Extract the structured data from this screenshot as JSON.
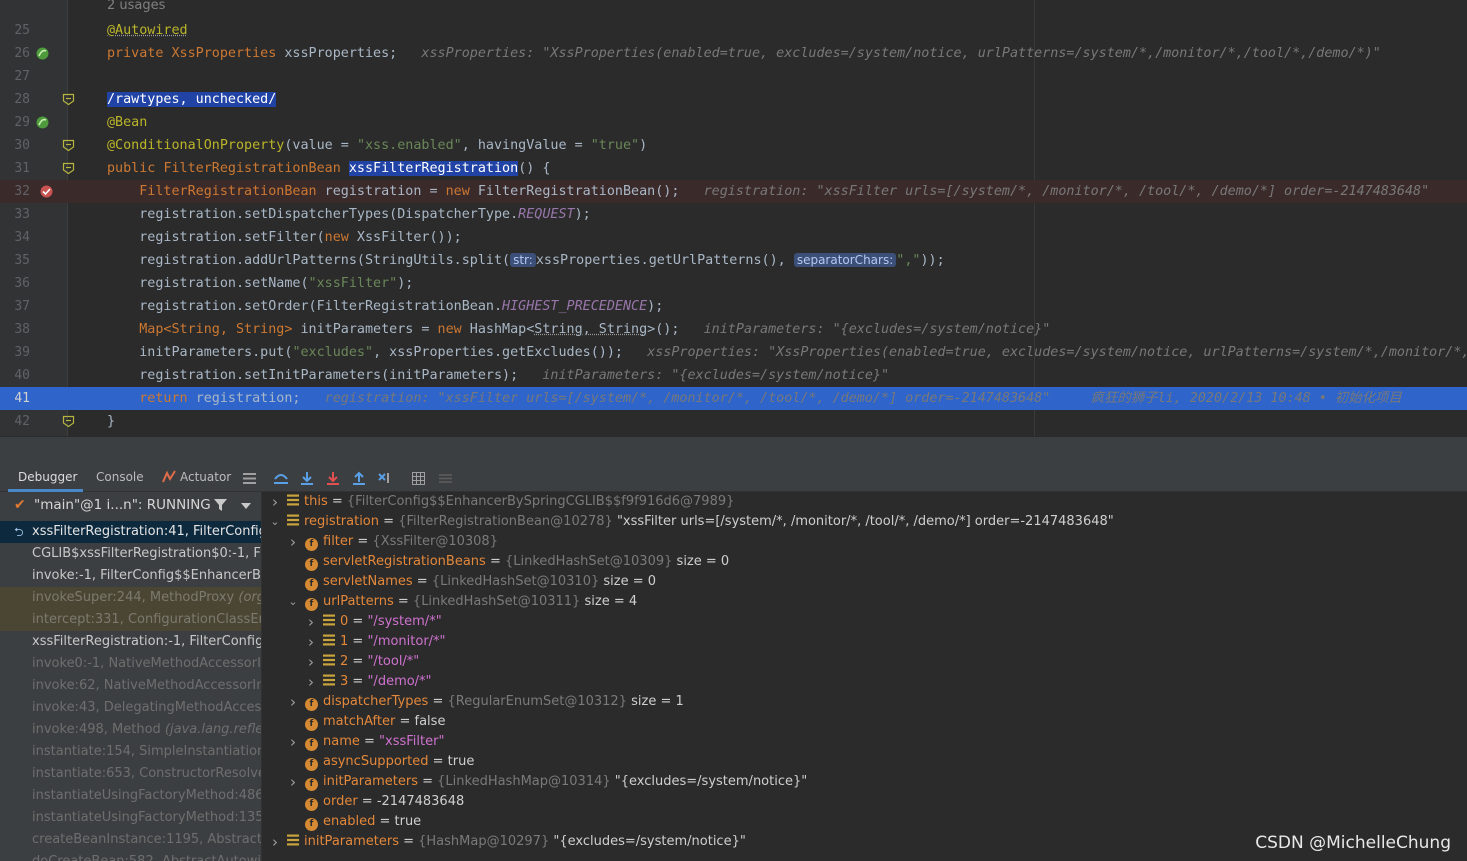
{
  "editor": {
    "usages": "2 usages",
    "lines": [
      {
        "num": "25",
        "parts": [
          {
            "t": "@Autowired",
            "c": "ann wavy"
          }
        ]
      },
      {
        "num": "26",
        "parts": [
          {
            "t": "private ",
            "c": "kw"
          },
          {
            "t": "XssProperties ",
            "c": "kw"
          },
          {
            "t": "xssProperties;",
            "c": ""
          },
          {
            "t": "   xssProperties: \"XssProperties(enabled=true, excludes=/system/notice, urlPatterns=/system/*,/monitor/*,/tool/*,/demo/*)\"",
            "c": "inl"
          }
        ]
      },
      {
        "num": "27",
        "parts": []
      },
      {
        "num": "28",
        "parts": [
          {
            "t": "/rawtypes, unchecked/",
            "c": "sel"
          }
        ]
      },
      {
        "num": "29",
        "parts": [
          {
            "t": "@Bean",
            "c": "ann"
          }
        ]
      },
      {
        "num": "30",
        "parts": [
          {
            "t": "@ConditionalOnProperty",
            "c": "ann"
          },
          {
            "t": "(value = ",
            "c": ""
          },
          {
            "t": "\"xss.enabled\"",
            "c": "str"
          },
          {
            "t": ", havingValue = ",
            "c": ""
          },
          {
            "t": "\"true\"",
            "c": "str"
          },
          {
            "t": ")",
            "c": ""
          }
        ]
      },
      {
        "num": "31",
        "parts": [
          {
            "t": "public ",
            "c": "kw"
          },
          {
            "t": "FilterRegistrationBean ",
            "c": "kw"
          },
          {
            "t": "xssFilterRegistration",
            "c": "sel"
          },
          {
            "t": "() {",
            "c": ""
          }
        ]
      },
      {
        "num": "32",
        "parts": [
          {
            "t": "    FilterRegistrationBean ",
            "c": "kw"
          },
          {
            "t": "registration ",
            "c": ""
          },
          {
            "t": "= ",
            "c": ""
          },
          {
            "t": "new ",
            "c": "kw"
          },
          {
            "t": "FilterRegistrationBean",
            "c": ""
          },
          {
            "t": "();",
            "c": ""
          },
          {
            "t": "   registration: \"xssFilter urls=[/system/*, /monitor/*, /tool/*, /demo/*] order=-2147483648\"",
            "c": "inl"
          }
        ]
      },
      {
        "num": "33",
        "parts": [
          {
            "t": "    registration.setDispatcherTypes(DispatcherType.",
            "c": ""
          },
          {
            "t": "REQUEST",
            "c": "stat"
          },
          {
            "t": ");",
            "c": ""
          }
        ]
      },
      {
        "num": "34",
        "parts": [
          {
            "t": "    registration.setFilter(",
            "c": ""
          },
          {
            "t": "new ",
            "c": "kw"
          },
          {
            "t": "XssFilter());",
            "c": ""
          }
        ]
      },
      {
        "num": "35",
        "parts": [
          {
            "t": "    registration.addUrlPatterns(StringUtils.split(",
            "c": ""
          },
          {
            "t": "str:",
            "c": "hint"
          },
          {
            "t": "xssProperties.getUrlPatterns(), ",
            "c": ""
          },
          {
            "t": "separatorChars:",
            "c": "hint"
          },
          {
            "t": "\",\"",
            "c": "str"
          },
          {
            "t": "));",
            "c": ""
          }
        ]
      },
      {
        "num": "36",
        "parts": [
          {
            "t": "    registration.setName(",
            "c": ""
          },
          {
            "t": "\"xssFilter\"",
            "c": "str"
          },
          {
            "t": ");",
            "c": ""
          }
        ]
      },
      {
        "num": "37",
        "parts": [
          {
            "t": "    registration.setOrder(FilterRegistrationBean.",
            "c": ""
          },
          {
            "t": "HIGHEST_PRECEDENCE",
            "c": "stat"
          },
          {
            "t": ");",
            "c": ""
          }
        ]
      },
      {
        "num": "38",
        "parts": [
          {
            "t": "    Map<String, String> ",
            "c": "kw"
          },
          {
            "t": "initParameters = ",
            "c": ""
          },
          {
            "t": "new ",
            "c": "kw"
          },
          {
            "t": "HashMap<",
            "c": ""
          },
          {
            "t": "String, String",
            "c": "wavy"
          },
          {
            "t": ">();",
            "c": ""
          },
          {
            "t": "   initParameters: \"{excludes=/system/notice}\"",
            "c": "inl"
          }
        ]
      },
      {
        "num": "39",
        "parts": [
          {
            "t": "    initParameters.put(",
            "c": ""
          },
          {
            "t": "\"excludes\"",
            "c": "str"
          },
          {
            "t": ", xssProperties.getExcludes());",
            "c": ""
          },
          {
            "t": "   xssProperties: \"XssProperties(enabled=true, excludes=/system/notice, urlPatterns=/system/*,/monitor/*,/t",
            "c": "inl"
          }
        ]
      },
      {
        "num": "40",
        "parts": [
          {
            "t": "    registration.setInitParameters(initParameters);",
            "c": ""
          },
          {
            "t": "   initParameters: \"{excludes=/system/notice}\"",
            "c": "inl"
          }
        ]
      },
      {
        "num": "41",
        "parts": [
          {
            "t": "    return ",
            "c": "kw"
          },
          {
            "t": "registration;",
            "c": ""
          },
          {
            "t": "   registration: \"xssFilter urls=[/system/*, /monitor/*, /tool/*, /demo/*] order=-2147483648\"     疯狂的狮子li, 2020/2/13 10:48 • 初始化项目",
            "c": "inl"
          }
        ]
      },
      {
        "num": "42",
        "parts": [
          {
            "t": "}",
            "c": ""
          }
        ]
      }
    ]
  },
  "toolbar": {
    "tabs": [
      "Debugger",
      "Console",
      "Actuator"
    ]
  },
  "frames": {
    "thread": "\"main\"@1 i...n\": RUNNING",
    "items": [
      {
        "label": "xssFilterRegistration:41, FilterConfig",
        "pkg": "(",
        "kind": "active"
      },
      {
        "label": "CGLIB$xssFilterRegistration$0:-1, Filte",
        "pkg": "",
        "kind": "app"
      },
      {
        "label": "invoke:-1, FilterConfig$$EnhancerBySp",
        "pkg": "",
        "kind": "app"
      },
      {
        "label": "invokeSuper:244, MethodProxy ",
        "pkg": "(org.",
        "kind": "lib"
      },
      {
        "label": "intercept:331, ConfigurationClassEnh",
        "pkg": "",
        "kind": "lib"
      },
      {
        "label": "xssFilterRegistration:-1, FilterConfig$$",
        "pkg": "",
        "kind": "app"
      },
      {
        "label": "invoke0:-1, NativeMethodAccessorIm",
        "pkg": "",
        "kind": "libg"
      },
      {
        "label": "invoke:62, NativeMethodAccessorImp",
        "pkg": "",
        "kind": "libg"
      },
      {
        "label": "invoke:43, DelegatingMethodAccesso",
        "pkg": "",
        "kind": "libg"
      },
      {
        "label": "invoke:498, Method ",
        "pkg": "(java.lang.reflect.",
        "kind": "libg"
      },
      {
        "label": "instantiate:154, SimpleInstantiationSt",
        "pkg": "",
        "kind": "libg"
      },
      {
        "label": "instantiate:653, ConstructorResolver",
        "pkg": "",
        "kind": "libg"
      },
      {
        "label": "instantiateUsingFactoryMethod:486,",
        "pkg": "",
        "kind": "libg"
      },
      {
        "label": "instantiateUsingFactoryMethod:1352",
        "pkg": "",
        "kind": "libg"
      },
      {
        "label": "createBeanInstance:1195, AbstractAu",
        "pkg": "",
        "kind": "libg"
      },
      {
        "label": "doCreateBean:582, AbstractAutowire",
        "pkg": "",
        "kind": "libg"
      }
    ]
  },
  "variables": [
    {
      "depth": 0,
      "toggle": "›",
      "icon": "list",
      "name": "this",
      "type": "{FilterConfig$$EnhancerBySpringCGLIB$$f9f916d6@7989}",
      "value": "",
      "vclass": "vval"
    },
    {
      "depth": 0,
      "toggle": "⌄",
      "icon": "list",
      "name": "registration",
      "type": "{FilterRegistrationBean@10278}",
      "value": "\"xssFilter urls=[/system/*, /monitor/*, /tool/*, /demo/*] order=-2147483648\"",
      "vclass": "vval"
    },
    {
      "depth": 1,
      "toggle": "›",
      "icon": "f",
      "name": "filter",
      "type": "{XssFilter@10308}",
      "value": "",
      "vclass": "vval"
    },
    {
      "depth": 1,
      "toggle": "",
      "icon": "f",
      "name": "servletRegistrationBeans",
      "type": "{LinkedHashSet@10309}",
      "value": "size = 0",
      "vclass": "vval"
    },
    {
      "depth": 1,
      "toggle": "",
      "icon": "f",
      "name": "servletNames",
      "type": "{LinkedHashSet@10310}",
      "value": "size = 0",
      "vclass": "vval"
    },
    {
      "depth": 1,
      "toggle": "⌄",
      "icon": "f",
      "name": "urlPatterns",
      "type": "{LinkedHashSet@10311}",
      "value": "size = 4",
      "vclass": "vval"
    },
    {
      "depth": 2,
      "toggle": "›",
      "icon": "list",
      "name": "0",
      "type": "",
      "value": "\"/system/*\"",
      "vclass": "vstr"
    },
    {
      "depth": 2,
      "toggle": "›",
      "icon": "list",
      "name": "1",
      "type": "",
      "value": "\"/monitor/*\"",
      "vclass": "vstr"
    },
    {
      "depth": 2,
      "toggle": "›",
      "icon": "list",
      "name": "2",
      "type": "",
      "value": "\"/tool/*\"",
      "vclass": "vstr"
    },
    {
      "depth": 2,
      "toggle": "›",
      "icon": "list",
      "name": "3",
      "type": "",
      "value": "\"/demo/*\"",
      "vclass": "vstr"
    },
    {
      "depth": 1,
      "toggle": "›",
      "icon": "f",
      "name": "dispatcherTypes",
      "type": "{RegularEnumSet@10312}",
      "value": "size = 1",
      "vclass": "vval"
    },
    {
      "depth": 1,
      "toggle": "",
      "icon": "f",
      "name": "matchAfter",
      "type": "",
      "value": "false",
      "vclass": "vval"
    },
    {
      "depth": 1,
      "toggle": "›",
      "icon": "f",
      "name": "name",
      "type": "",
      "value": "\"xssFilter\"",
      "vclass": "vstr"
    },
    {
      "depth": 1,
      "toggle": "",
      "icon": "f",
      "name": "asyncSupported",
      "type": "",
      "value": "true",
      "vclass": "vval"
    },
    {
      "depth": 1,
      "toggle": "›",
      "icon": "f",
      "name": "initParameters",
      "type": "{LinkedHashMap@10314}",
      "value": "\"{excludes=/system/notice}\"",
      "vclass": "vval"
    },
    {
      "depth": 1,
      "toggle": "",
      "icon": "f",
      "name": "order",
      "type": "",
      "value": "-2147483648",
      "vclass": "vval"
    },
    {
      "depth": 1,
      "toggle": "",
      "icon": "f",
      "name": "enabled",
      "type": "",
      "value": "true",
      "vclass": "vval"
    },
    {
      "depth": 0,
      "toggle": "›",
      "icon": "list",
      "name": "initParameters",
      "type": "{HashMap@10297}",
      "value": "\"{excludes=/system/notice}\"",
      "vclass": "vval"
    }
  ],
  "watermark": "CSDN @MichelleChung"
}
